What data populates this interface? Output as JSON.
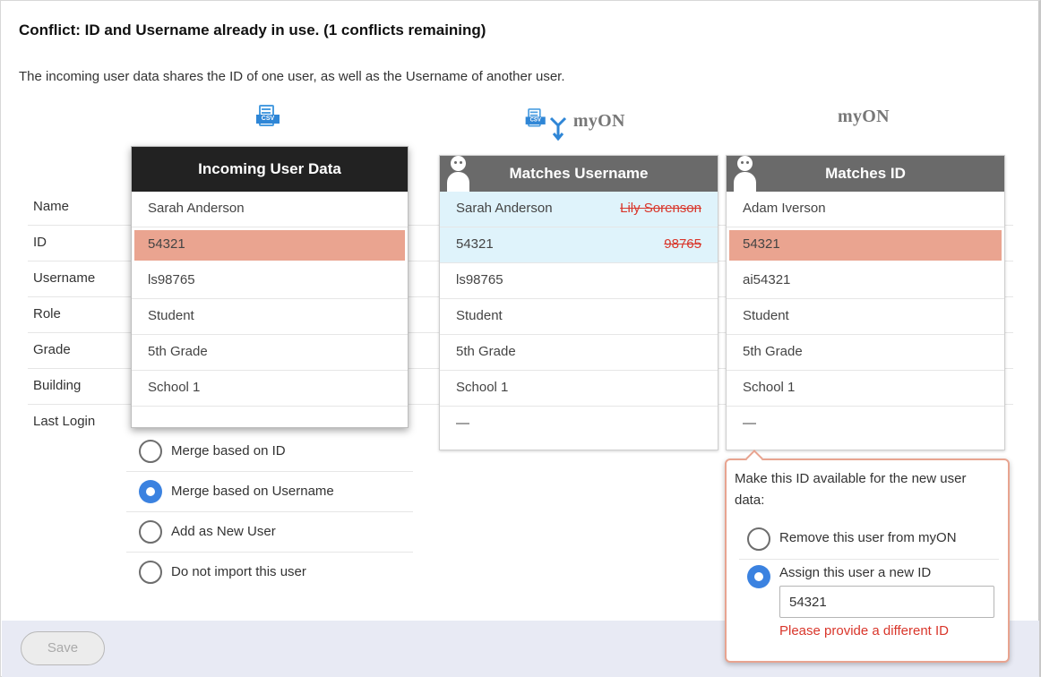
{
  "conflict": {
    "title": "Conflict: ID and Username already in use. (1 conflicts remaining)",
    "description": "The incoming user data shares the ID of one user, as well as the Username of another user."
  },
  "headers": {
    "csv_tag": "CSV",
    "myon_logo": "myON",
    "incoming": "Incoming User Data",
    "matches_username": "Matches Username",
    "matches_id": "Matches ID"
  },
  "row_labels": [
    "Name",
    "ID",
    "Username",
    "Role",
    "Grade",
    "Building",
    "Last Login"
  ],
  "incoming": {
    "name": "Sarah Anderson",
    "id": "54321",
    "username": "ls98765",
    "role": "Student",
    "grade": "5th Grade",
    "building": "School 1",
    "last_login": ""
  },
  "matches_username": {
    "name": "Sarah Anderson",
    "name_old": "Lily Sorenson",
    "id": "54321",
    "id_old": "98765",
    "username": "ls98765",
    "role": "Student",
    "grade": "5th Grade",
    "building": "School 1",
    "last_login": "—"
  },
  "matches_id": {
    "name": "Adam Iverson",
    "id": "54321",
    "username": "ai54321",
    "role": "Student",
    "grade": "5th Grade",
    "building": "School 1",
    "last_login": "—"
  },
  "options": [
    {
      "label": "Merge based on ID",
      "selected": false
    },
    {
      "label": "Merge based on Username",
      "selected": true
    },
    {
      "label": "Add as New User",
      "selected": false
    },
    {
      "label": "Do not import this user",
      "selected": false
    }
  ],
  "popover": {
    "message": "Make this ID available for the new user data:",
    "remove_label": "Remove this user from myON",
    "assign_label": "Assign this user a new ID",
    "new_id_value": "54321",
    "error": "Please provide a different ID"
  },
  "footer": {
    "save_label": "Save"
  },
  "colors": {
    "conflict_highlight": "#eaa490",
    "match_highlight": "#dff3fb",
    "accent": "#3b82e0",
    "error": "#d9362b"
  }
}
